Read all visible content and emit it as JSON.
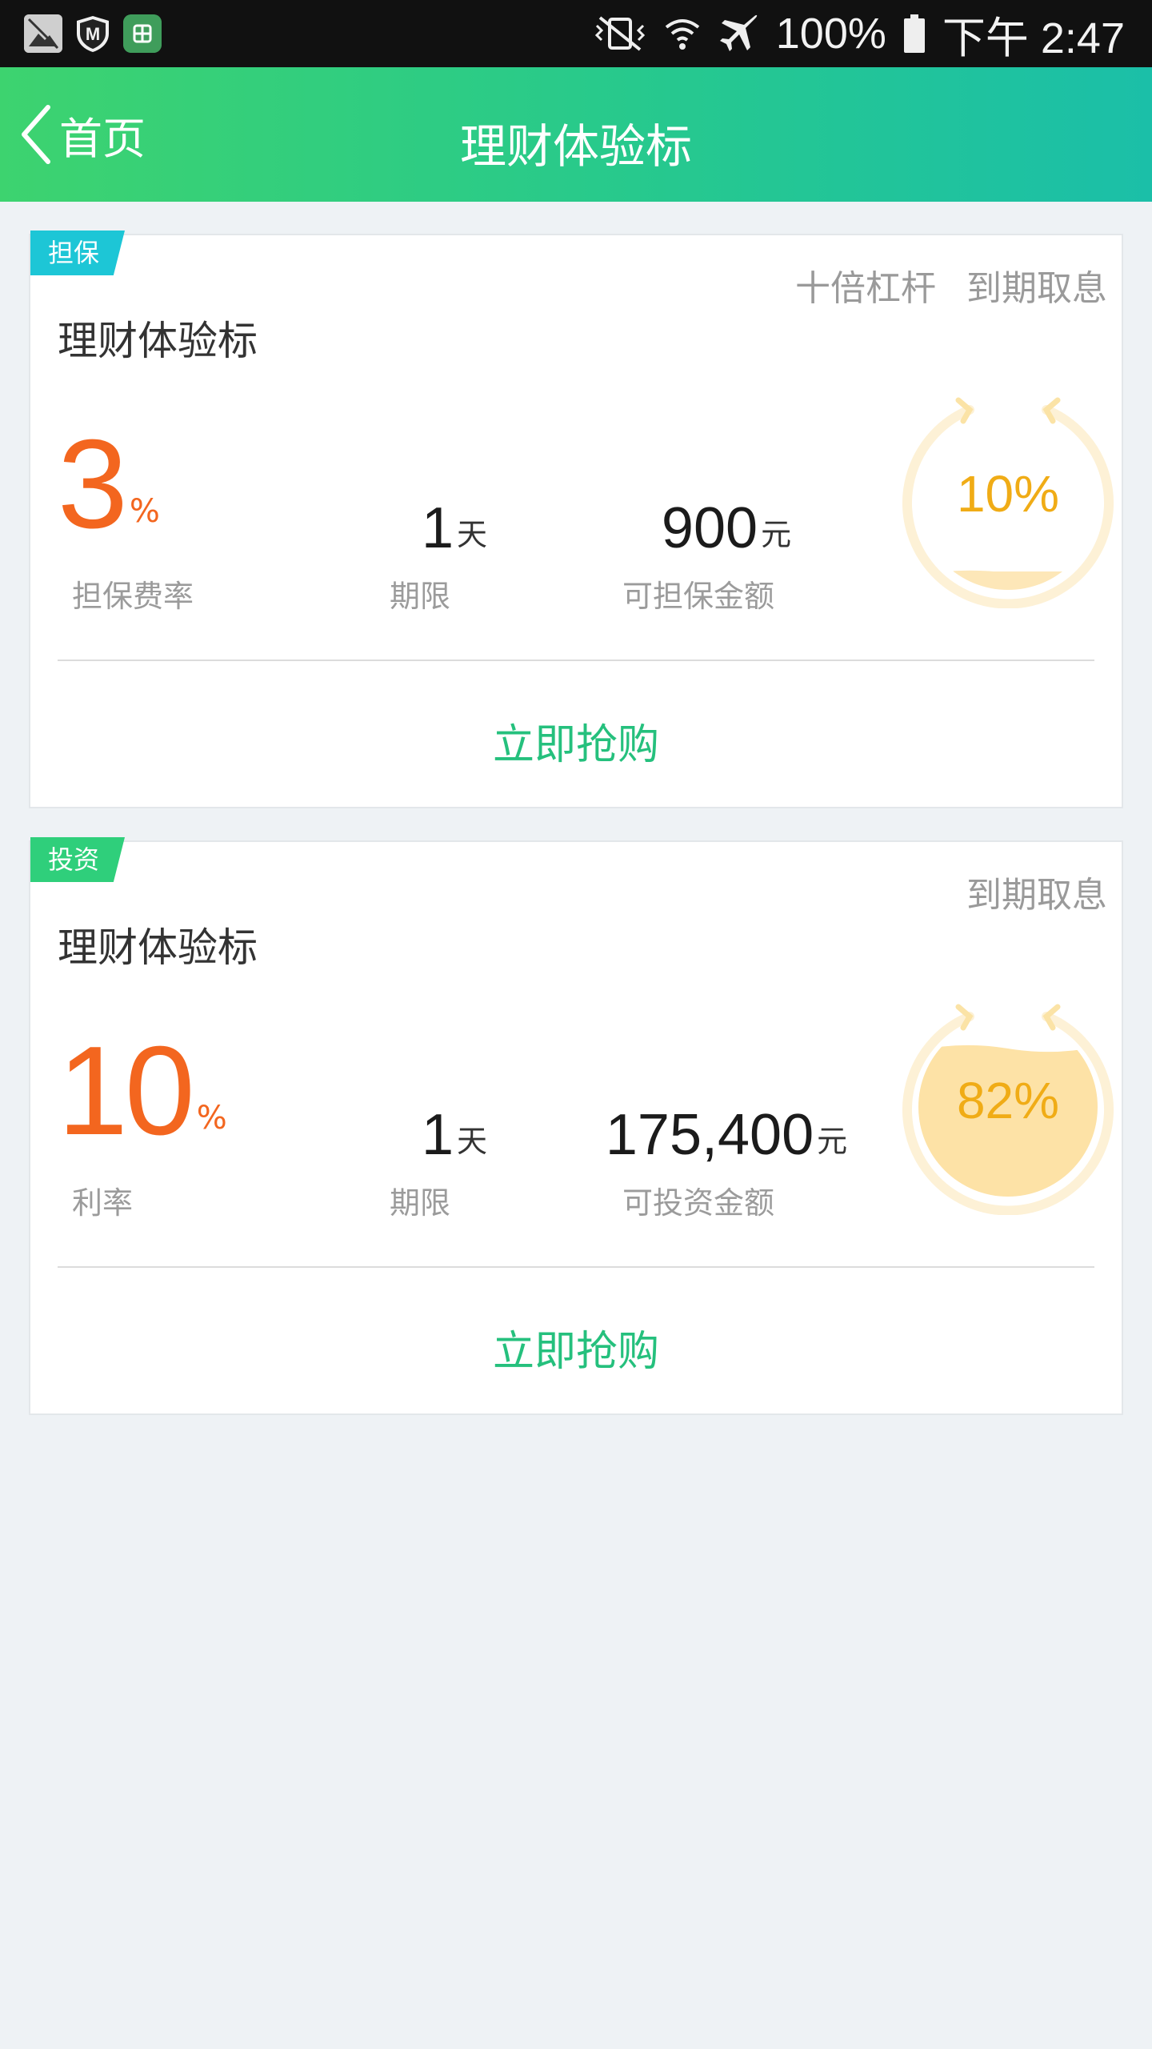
{
  "status_bar": {
    "battery": "100%",
    "time": "下午 2:47",
    "icons": [
      "gallery-icon",
      "shield-m-icon",
      "app-icon",
      "vibrate-icon",
      "wifi-icon",
      "airplane-icon",
      "battery-icon"
    ]
  },
  "header": {
    "back_label": "首页",
    "title": "理财体验标"
  },
  "products": [
    {
      "badge": "担保",
      "badge_color": "#1dc6d6",
      "tags": [
        "十倍杠杆",
        "到期取息"
      ],
      "title": "理财体验标",
      "rate_value": "3",
      "rate_unit": "%",
      "rate_label": "担保费率",
      "term_value": "1",
      "term_unit": "天",
      "term_label": "期限",
      "amount_value": "900",
      "amount_unit": "元",
      "amount_label": "可担保金额",
      "progress_text": "10%",
      "progress": 0.1,
      "buy_label": "立即抢购"
    },
    {
      "badge": "投资",
      "badge_color": "#2fcf7b",
      "tags": [
        "到期取息"
      ],
      "title": "理财体验标",
      "rate_value": "10",
      "rate_unit": "%",
      "rate_label": "利率",
      "term_value": "1",
      "term_unit": "天",
      "term_label": "期限",
      "amount_value": "175,400",
      "amount_unit": "元",
      "amount_label": "可投资金额",
      "progress_text": "82%",
      "progress": 0.82,
      "buy_label": "立即抢购"
    }
  ],
  "colors": {
    "header_start": "#3dd36f",
    "header_end": "#1bbfa8",
    "rate": "#f3661f",
    "buy": "#25c07d",
    "gauge": "#f0ac16"
  }
}
